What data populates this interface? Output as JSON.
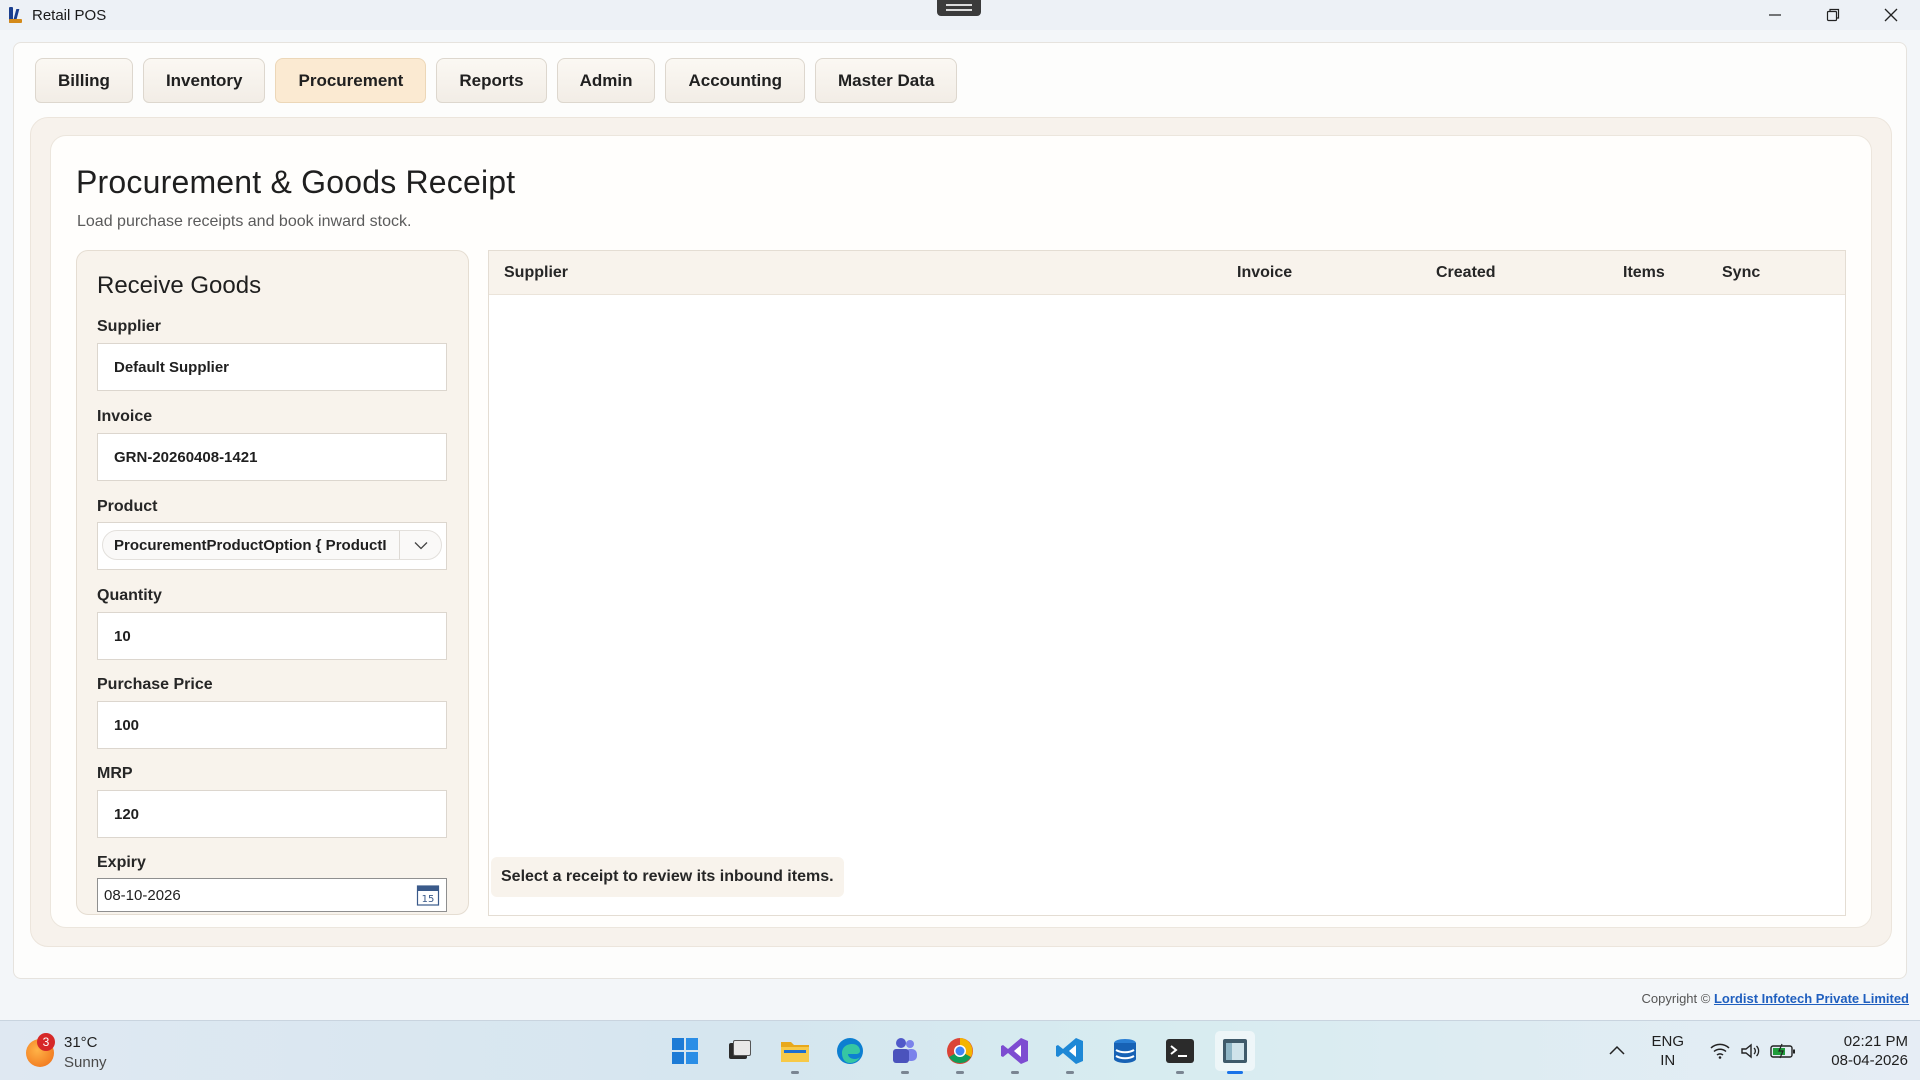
{
  "app": {
    "title": "Retail POS"
  },
  "tabs": [
    {
      "label": "Billing",
      "active": false
    },
    {
      "label": "Inventory",
      "active": false
    },
    {
      "label": "Procurement",
      "active": true
    },
    {
      "label": "Reports",
      "active": false
    },
    {
      "label": "Admin",
      "active": false
    },
    {
      "label": "Accounting",
      "active": false
    },
    {
      "label": "Master Data",
      "active": false
    }
  ],
  "page": {
    "title": "Procurement & Goods Receipt",
    "subtitle": "Load purchase receipts and book inward stock."
  },
  "form": {
    "title": "Receive Goods",
    "supplier_label": "Supplier",
    "supplier_value": "Default Supplier",
    "invoice_label": "Invoice",
    "invoice_value": "GRN-20260408-1421",
    "product_label": "Product",
    "product_value": "ProcurementProductOption { ProductI",
    "quantity_label": "Quantity",
    "quantity_value": "10",
    "purchase_price_label": "Purchase Price",
    "purchase_price_value": "100",
    "mrp_label": "MRP",
    "mrp_value": "120",
    "expiry_label": "Expiry",
    "expiry_value": "08-10-2026",
    "calendar_day": "15"
  },
  "grid": {
    "columns": [
      "Supplier",
      "Invoice",
      "Created",
      "Items",
      "Sync"
    ],
    "rows": [],
    "hint": "Select a receipt to review its inbound items."
  },
  "footer": {
    "copyright_prefix": "Copyright ©",
    "company": "Lordist Infotech Private Limited"
  },
  "taskbar": {
    "weather_badge": "3",
    "temperature": "31°C",
    "condition": "Sunny",
    "lang_top": "ENG",
    "lang_bottom": "IN",
    "time": "02:21 PM",
    "date": "08-04-2026",
    "icons": [
      "start-icon",
      "task-view-icon",
      "file-explorer-icon",
      "edge-icon",
      "teams-icon",
      "chrome-icon",
      "visual-studio-icon",
      "vscode-icon",
      "azure-data-studio-icon",
      "terminal-icon",
      "retail-pos-icon"
    ]
  },
  "colors": {
    "accent_tab": "#fbead2",
    "panel_bg": "#f8f3ec",
    "link": "#1f5fbf"
  }
}
